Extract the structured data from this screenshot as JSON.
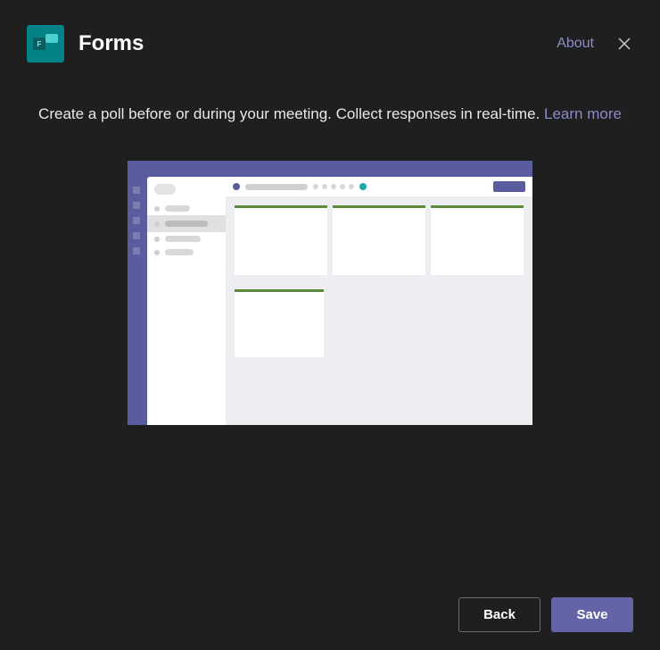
{
  "header": {
    "app_title": "Forms",
    "about_label": "About"
  },
  "description": {
    "text": "Create a poll before or during your meeting. Collect responses in real-time.",
    "learn_more_label": "Learn more"
  },
  "footer": {
    "back_label": "Back",
    "save_label": "Save"
  }
}
